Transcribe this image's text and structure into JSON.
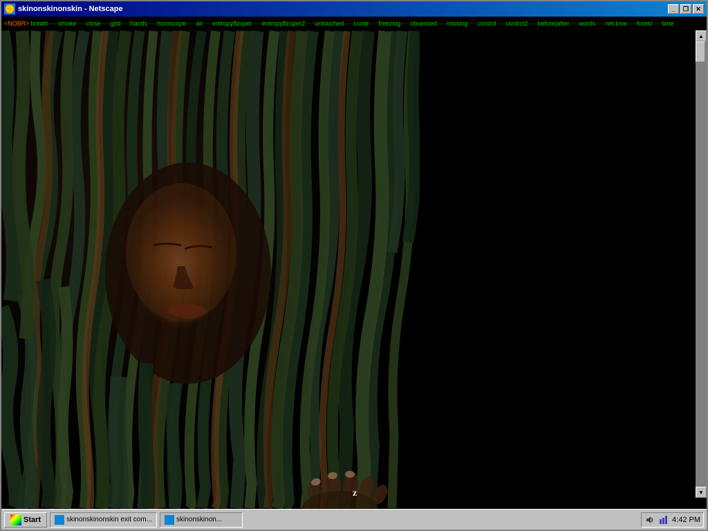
{
  "window": {
    "title": "skinonskinonskin - Netscape",
    "icon": "netscape-icon"
  },
  "title_buttons": {
    "minimize": "_",
    "restore": "❐",
    "close": "✕"
  },
  "nav": {
    "tag": "<NOBR>",
    "links": [
      "breath",
      "smoke",
      "close",
      "grid",
      "hands",
      "horoscope",
      "air",
      "entropy8zuper",
      "entropy8zuper2",
      "untouched",
      "come",
      "freezing",
      "obsessed",
      "missing",
      "control",
      "control2",
      "before|after",
      "words",
      "net.love",
      "forest",
      "time"
    ]
  },
  "scrollbar": {
    "up_arrow": "▲",
    "down_arrow": "▼"
  },
  "taskbar": {
    "start_label": "Start",
    "items": [
      {
        "label": "skinonskinonskin exit com...",
        "active": false
      },
      {
        "label": "skinonskinon...",
        "active": true
      }
    ],
    "clock": "4:42 PM"
  }
}
